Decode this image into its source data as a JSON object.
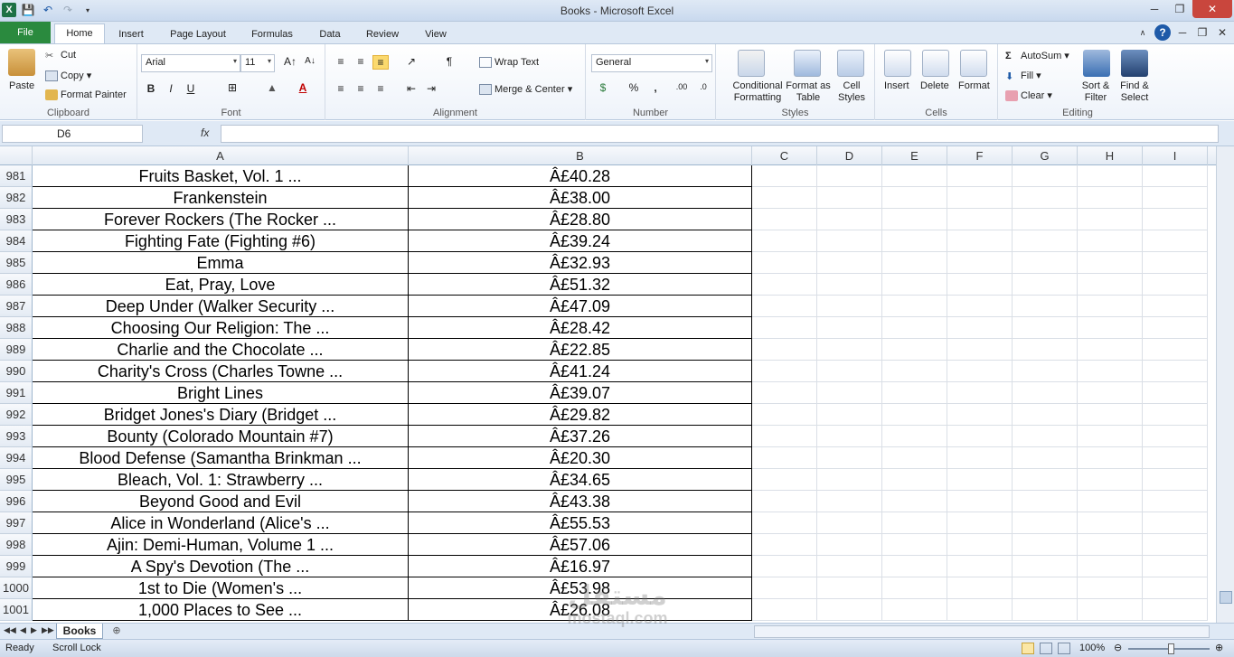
{
  "window": {
    "title": "Books - Microsoft Excel"
  },
  "ribbon_tabs": [
    "File",
    "Home",
    "Insert",
    "Page Layout",
    "Formulas",
    "Data",
    "Review",
    "View"
  ],
  "clipboard": {
    "paste": "Paste",
    "cut": "Cut",
    "copy": "Copy",
    "format_painter": "Format Painter",
    "label": "Clipboard"
  },
  "font": {
    "name": "Arial",
    "size": "11",
    "label": "Font"
  },
  "alignment": {
    "wrap_text": "Wrap Text",
    "merge_center": "Merge & Center",
    "label": "Alignment"
  },
  "number": {
    "format": "General",
    "label": "Number"
  },
  "styles": {
    "conditional": "Conditional Formatting",
    "format_table": "Format as Table",
    "cell_styles": "Cell Styles",
    "label": "Styles"
  },
  "cells": {
    "insert": "Insert",
    "delete": "Delete",
    "format": "Format",
    "label": "Cells"
  },
  "editing": {
    "autosum": "AutoSum",
    "fill": "Fill",
    "clear": "Clear",
    "sort_filter": "Sort & Filter",
    "find_select": "Find & Select",
    "label": "Editing"
  },
  "formula_bar": {
    "name_box": "D6",
    "fx": "fx",
    "content": ""
  },
  "columns": [
    "A",
    "B",
    "C",
    "D",
    "E",
    "F",
    "G",
    "H",
    "I"
  ],
  "rows": [
    {
      "num": "981",
      "a": "Fruits Basket, Vol. 1 ...",
      "b": "Â£40.28"
    },
    {
      "num": "982",
      "a": "Frankenstein",
      "b": "Â£38.00"
    },
    {
      "num": "983",
      "a": "Forever Rockers (The Rocker ...",
      "b": "Â£28.80"
    },
    {
      "num": "984",
      "a": "Fighting Fate (Fighting #6)",
      "b": "Â£39.24"
    },
    {
      "num": "985",
      "a": "Emma",
      "b": "Â£32.93"
    },
    {
      "num": "986",
      "a": "Eat, Pray, Love",
      "b": "Â£51.32"
    },
    {
      "num": "987",
      "a": "Deep Under (Walker Security ...",
      "b": "Â£47.09"
    },
    {
      "num": "988",
      "a": "Choosing Our Religion: The ...",
      "b": "Â£28.42"
    },
    {
      "num": "989",
      "a": "Charlie and the Chocolate ...",
      "b": "Â£22.85"
    },
    {
      "num": "990",
      "a": "Charity's Cross (Charles Towne ...",
      "b": "Â£41.24"
    },
    {
      "num": "991",
      "a": "Bright Lines",
      "b": "Â£39.07"
    },
    {
      "num": "992",
      "a": "Bridget Jones's Diary (Bridget ...",
      "b": "Â£29.82"
    },
    {
      "num": "993",
      "a": "Bounty (Colorado Mountain #7)",
      "b": "Â£37.26"
    },
    {
      "num": "994",
      "a": "Blood Defense (Samantha Brinkman ...",
      "b": "Â£20.30"
    },
    {
      "num": "995",
      "a": "Bleach, Vol. 1: Strawberry ...",
      "b": "Â£34.65"
    },
    {
      "num": "996",
      "a": "Beyond Good and Evil",
      "b": "Â£43.38"
    },
    {
      "num": "997",
      "a": "Alice in Wonderland (Alice's ...",
      "b": "Â£55.53"
    },
    {
      "num": "998",
      "a": "Ajin: Demi-Human, Volume 1 ...",
      "b": "Â£57.06"
    },
    {
      "num": "999",
      "a": "A Spy's Devotion (The ...",
      "b": "Â£16.97"
    },
    {
      "num": "1000",
      "a": "1st to Die (Women's ...",
      "b": "Â£53.98"
    },
    {
      "num": "1001",
      "a": "1,000 Places to See ...",
      "b": "Â£26.08"
    }
  ],
  "sheet_tab": "Books",
  "status": {
    "ready": "Ready",
    "scroll_lock": "Scroll Lock",
    "zoom": "100%"
  },
  "watermark": {
    "line1": "مستقل",
    "line2": "mostaql.com"
  }
}
